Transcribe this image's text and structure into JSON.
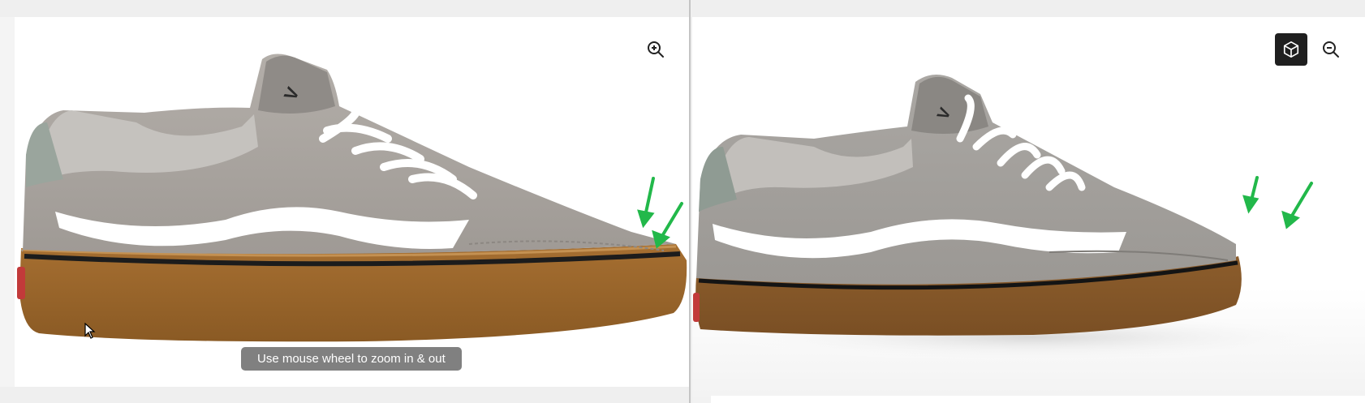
{
  "viewer": {
    "zoom_hint": "Use mouse wheel to zoom in & out"
  },
  "left_view": {
    "image": "photo-of-grey-suede-sneaker",
    "zoom_icon": "zoom-in-icon",
    "annotation_arrows": 2,
    "arrow_color": "#22b84a"
  },
  "right_view": {
    "image": "3d-render-of-grey-suede-sneaker",
    "view3d_icon": "cube-icon",
    "zoom_icon": "zoom-out-icon",
    "annotation_arrows": 2,
    "arrow_color": "#22b84a"
  },
  "colors": {
    "suede": "#a8a39f",
    "sole_gum": "#9a6427",
    "stripe": "#ffffff",
    "button_dark": "#1f1f1f"
  }
}
